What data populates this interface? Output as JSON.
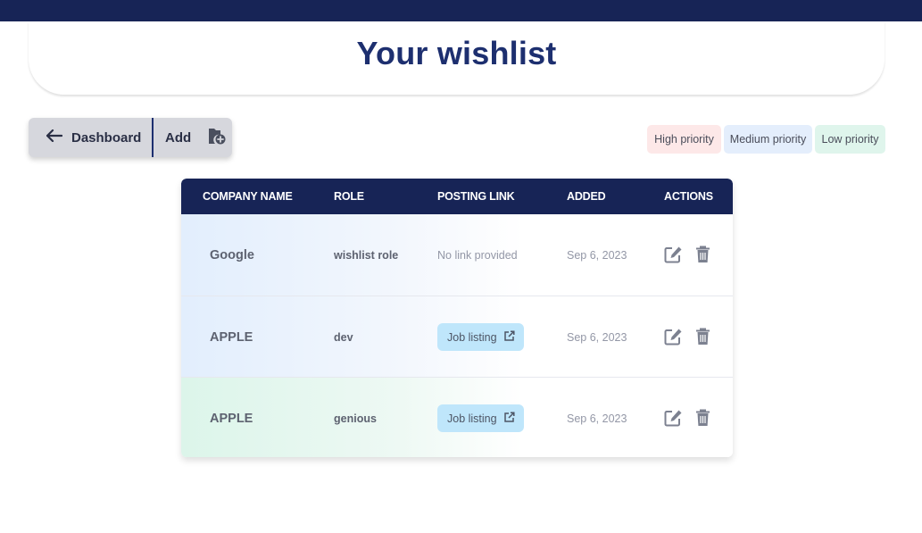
{
  "header": {
    "title": "Your wishlist"
  },
  "toolbar": {
    "dashboard_label": "Dashboard",
    "add_label": "Add"
  },
  "legend": {
    "high": "High priority",
    "medium": "Medium priority",
    "low": "Low priority",
    "colors": {
      "high": "#fde8e8",
      "medium": "#e4eefc",
      "low": "#dff5ec"
    }
  },
  "table": {
    "columns": [
      "COMPANY NAME",
      "ROLE",
      "POSTING LINK",
      "ADDED",
      "ACTIONS"
    ],
    "rows": [
      {
        "company": "Google",
        "role": "wishlist role",
        "link_text": "No link provided",
        "added": "Sep 6, 2023",
        "priority": "medium"
      },
      {
        "company": "APPLE",
        "role": "dev",
        "link_text": "Job listing",
        "added": "Sep 6, 2023",
        "priority": "medium"
      },
      {
        "company": "APPLE",
        "role": "genious",
        "link_text": "Job listing",
        "added": "Sep 6, 2023",
        "priority": "low"
      }
    ]
  },
  "icons": {
    "back": "arrow-left-icon",
    "add": "folder-plus-icon",
    "external": "external-link-icon",
    "edit": "edit-icon",
    "delete": "trash-icon"
  },
  "colors": {
    "navy": "#172456",
    "title": "#1d2f6f",
    "link_bg": "#bfe6fb"
  }
}
